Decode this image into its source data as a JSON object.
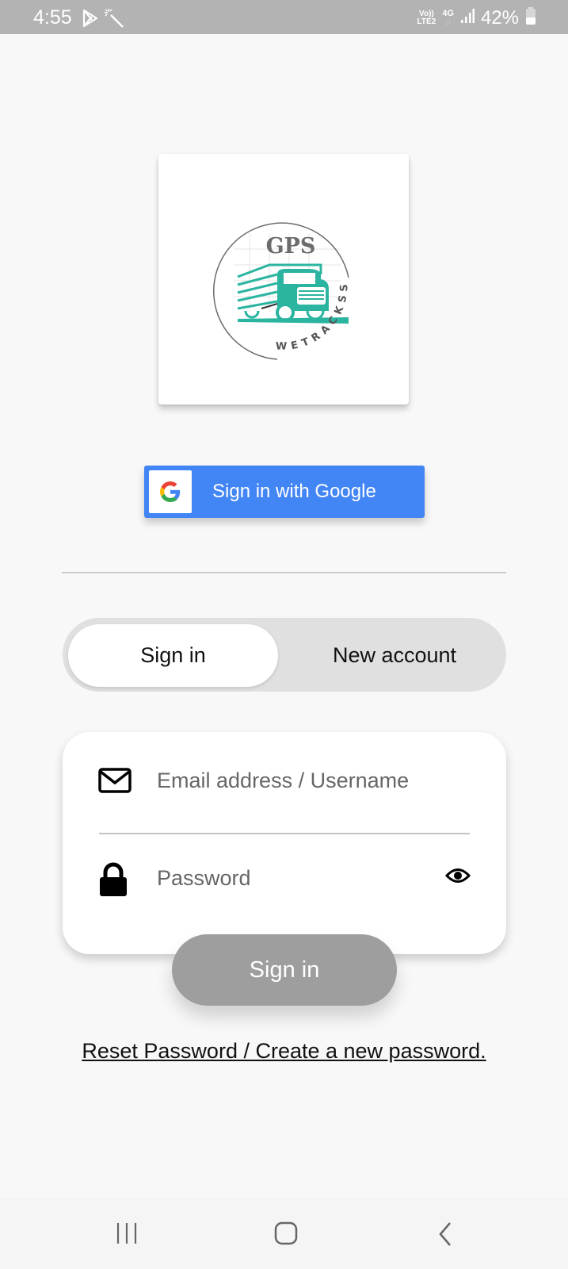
{
  "status_bar": {
    "time": "4:55",
    "volte_line1": "Vo))",
    "volte_line2": "LTE2",
    "network": "4G",
    "battery": "42%",
    "icons": [
      "play-store-icon",
      "magic-wand-icon",
      "signal-icon",
      "battery-icon"
    ]
  },
  "logo": {
    "title": "GPS",
    "brand": "WETRACKSS",
    "accent_color": "#2bb5a0"
  },
  "google_button": {
    "label": "Sign in with Google",
    "color": "#4285f4"
  },
  "auth_tabs": {
    "active": "Sign in",
    "items": [
      {
        "label": "Sign in"
      },
      {
        "label": "New account"
      }
    ]
  },
  "form": {
    "email_placeholder": "Email address / Username",
    "email_value": "",
    "password_placeholder": "Password",
    "password_value": "",
    "submit_label": "Sign in"
  },
  "reset_link": "Reset Password / Create a new password.",
  "nav_bar": {
    "icons": [
      "recent-apps-icon",
      "home-icon",
      "back-icon"
    ]
  }
}
